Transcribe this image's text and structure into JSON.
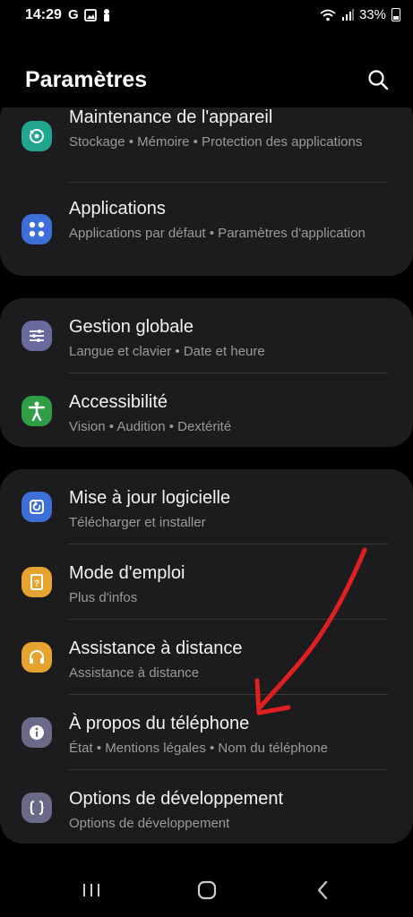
{
  "status": {
    "time": "14:29",
    "battery": "33%",
    "carrier_icon": "G"
  },
  "header": {
    "title": "Paramètres"
  },
  "card1": [
    {
      "label": "Maintenance de l'appareil",
      "sub": "Stockage • Mémoire • Protection des applications",
      "icon_color": "#22a58f",
      "icon": "maintenance-icon"
    },
    {
      "label": "Applications",
      "sub": "Applications par défaut • Paramètres d'application",
      "icon_color": "#3d6fd8",
      "icon": "apps-grid-icon"
    }
  ],
  "card2": [
    {
      "label": "Gestion globale",
      "sub": "Langue et clavier • Date et heure",
      "icon_color": "#6a6aa0",
      "icon": "sliders-icon"
    },
    {
      "label": "Accessibilité",
      "sub": "Vision • Audition • Dextérité",
      "icon_color": "#2f9e44",
      "icon": "accessibility-icon"
    }
  ],
  "card3": [
    {
      "label": "Mise à jour logicielle",
      "sub": "Télécharger et installer",
      "icon_color": "#3d6fd8",
      "icon": "update-icon"
    },
    {
      "label": "Mode d'emploi",
      "sub": "Plus d'infos",
      "icon_color": "#e5a430",
      "icon": "manual-icon"
    },
    {
      "label": "Assistance à distance",
      "sub": "Assistance à distance",
      "icon_color": "#e5a430",
      "icon": "headset-icon"
    },
    {
      "label": "À propos du téléphone",
      "sub": "État • Mentions légales • Nom du téléphone",
      "icon_color": "#6a6a88",
      "icon": "info-icon"
    },
    {
      "label": "Options de développement",
      "sub": "Options de développement",
      "icon_color": "#6a6a88",
      "icon": "braces-icon"
    }
  ],
  "annotation": {
    "arrow_color": "#e02020",
    "arrow_target": "À propos du téléphone"
  },
  "navbar": {
    "recents": "recents-icon",
    "home": "home-icon",
    "back": "back-icon"
  }
}
